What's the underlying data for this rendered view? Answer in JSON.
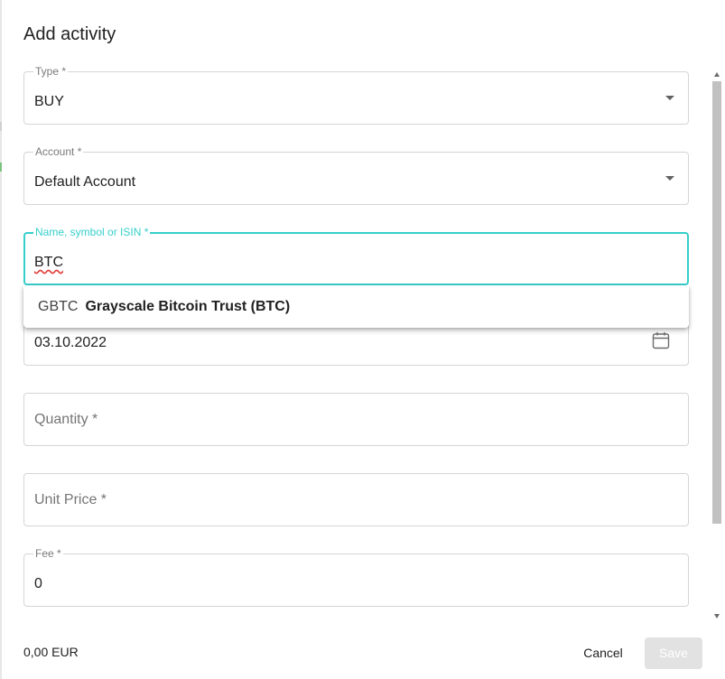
{
  "dialog": {
    "title": "Add activity"
  },
  "fields": {
    "type": {
      "label": "Type *",
      "value": "BUY"
    },
    "account": {
      "label": "Account *",
      "value": "Default Account"
    },
    "search": {
      "label": "Name, symbol or ISIN *",
      "value": "BTC"
    },
    "date": {
      "value": "03.10.2022"
    },
    "quantity": {
      "placeholder": "Quantity *"
    },
    "unit_price": {
      "placeholder": "Unit Price *"
    },
    "fee": {
      "label": "Fee *",
      "value": "0"
    }
  },
  "autocomplete": {
    "options": [
      {
        "symbol": "GBTC",
        "name": "Grayscale Bitcoin Trust (BTC)"
      }
    ]
  },
  "footer": {
    "total": "0,00 EUR",
    "cancel_label": "Cancel",
    "save_label": "Save"
  },
  "colors": {
    "accent": "#36cfcc",
    "save_disabled": "#e2e2e2"
  },
  "icons": {
    "dropdown": "chevron-down-icon",
    "date": "calendar-icon"
  }
}
